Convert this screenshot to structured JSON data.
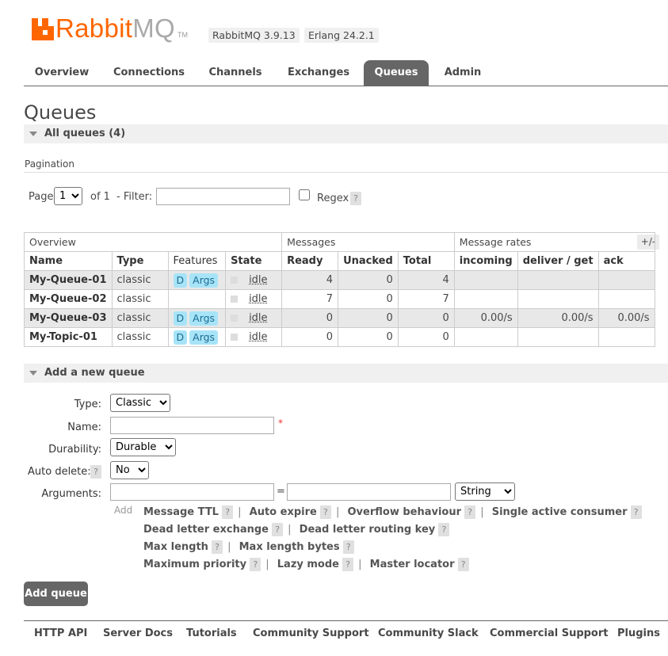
{
  "brand": {
    "logo_rabbit": "Rabbit",
    "logo_mq": "MQ",
    "logo_tm": "TM",
    "version": "RabbitMQ 3.9.13",
    "erlang": "Erlang 24.2.1",
    "accent_color": "#ff6600"
  },
  "tabs": [
    {
      "label": "Overview"
    },
    {
      "label": "Connections"
    },
    {
      "label": "Channels"
    },
    {
      "label": "Exchanges"
    },
    {
      "label": "Queues",
      "active": true
    },
    {
      "label": "Admin"
    }
  ],
  "page_title": "Queues",
  "all_queues": {
    "label": "All queues (4)"
  },
  "pagination": {
    "heading": "Pagination",
    "page_label": "Page",
    "page_value": "1",
    "of_label": "of 1",
    "filter_label": "- Filter:",
    "filter_value": "",
    "regex_label": "Regex",
    "help": "?"
  },
  "table": {
    "groups": [
      "Overview",
      "Messages",
      "Message rates"
    ],
    "plus_minus": "+/-",
    "headers": [
      "Name",
      "Type",
      "Features",
      "State",
      "Ready",
      "Unacked",
      "Total",
      "incoming",
      "deliver / get",
      "ack"
    ],
    "rows": [
      {
        "name": "My-Queue-01",
        "type": "classic",
        "features": [
          "D",
          "Args"
        ],
        "state": "idle",
        "ready": "4",
        "unacked": "0",
        "total": "4",
        "incoming": "",
        "deliver": "",
        "ack": ""
      },
      {
        "name": "My-Queue-02",
        "type": "classic",
        "features": [],
        "state": "idle",
        "ready": "7",
        "unacked": "0",
        "total": "7",
        "incoming": "",
        "deliver": "",
        "ack": ""
      },
      {
        "name": "My-Queue-03",
        "type": "classic",
        "features": [
          "D",
          "Args"
        ],
        "state": "idle",
        "ready": "0",
        "unacked": "0",
        "total": "0",
        "incoming": "0.00/s",
        "deliver": "0.00/s",
        "ack": "0.00/s"
      },
      {
        "name": "My-Topic-01",
        "type": "classic",
        "features": [
          "D",
          "Args"
        ],
        "state": "idle",
        "ready": "0",
        "unacked": "0",
        "total": "0",
        "incoming": "",
        "deliver": "",
        "ack": ""
      }
    ]
  },
  "add_queue": {
    "section_label": "Add a new queue",
    "type_label": "Type:",
    "type_value": "Classic",
    "name_label": "Name:",
    "name_value": "",
    "required_mark": "*",
    "durability_label": "Durability:",
    "durability_value": "Durable",
    "auto_delete_label": "Auto delete:",
    "auto_delete_value": "No",
    "arguments_label": "Arguments:",
    "equals": "=",
    "arg_type_value": "String",
    "add_label": "Add",
    "arg_links": [
      [
        "Message TTL",
        "Auto expire",
        "Overflow behaviour",
        "Single active consumer"
      ],
      [
        "Dead letter exchange",
        "Dead letter routing key"
      ],
      [
        "Max length",
        "Max length bytes"
      ],
      [
        "Maximum priority",
        "Lazy mode",
        "Master locator"
      ]
    ],
    "button_label": "Add queue"
  },
  "footer": [
    "HTTP API",
    "Server Docs",
    "Tutorials",
    "Community Support",
    "Community Slack",
    "Commercial Support",
    "Plugins"
  ]
}
